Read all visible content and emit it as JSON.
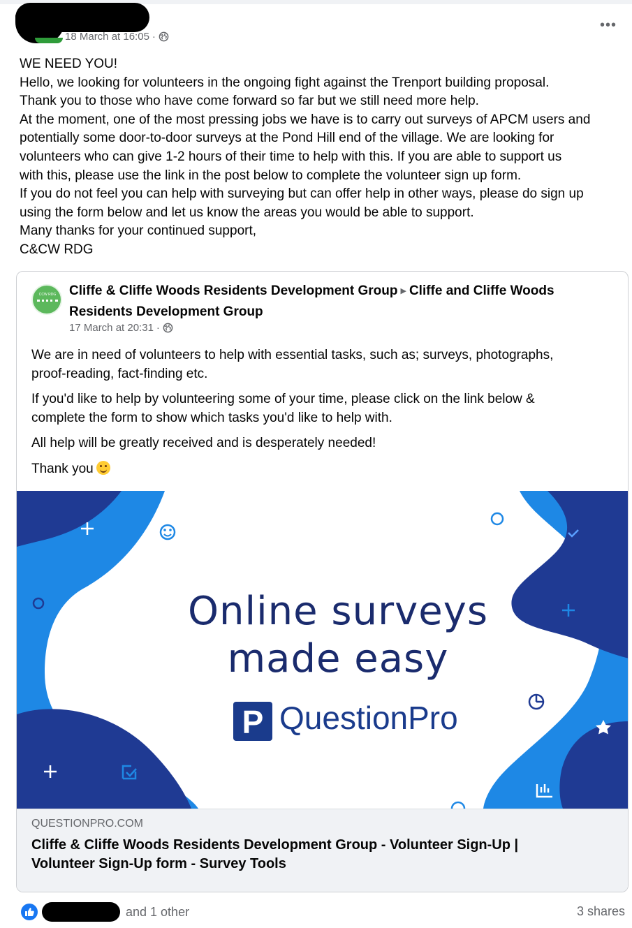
{
  "post": {
    "timestamp": "18 March at 16:05",
    "audience_icon": "globe-icon",
    "more_label": "•••",
    "body_lines": [
      "WE NEED YOU!",
      "Hello, we looking for volunteers in the ongoing fight against the Trenport building proposal.",
      "Thank you to those who have come forward so far but we still need more help.",
      "At the moment, one of the most pressing jobs we have is to carry out surveys of APCM users and",
      "potentially some door-to-door surveys at the Pond Hill end of the village. We are looking for",
      "volunteers who can give 1-2 hours of their time to help with this. If you are able to support us",
      "with this, please use the link in the post below to complete the volunteer sign up form.",
      "If you do not feel you can help with surveying but can offer help in other ways, please do sign up",
      "using the form below and let us know the areas you would be able to support.",
      "Many thanks for your continued support,",
      "C&CW RDG"
    ]
  },
  "shared_post": {
    "author": "Cliffe & Cliffe Woods Residents Development Group",
    "target_line1": "Cliffe and Cliffe Woods",
    "target_line2": "Residents Development Group",
    "timestamp": "17 March at 20:31",
    "paragraphs": [
      [
        "We are in need of volunteers to help with essential tasks, such as; surveys, photographs,",
        "proof-reading, fact-finding etc."
      ],
      [
        "If you'd like to help by volunteering some of your time, please click on the link below &",
        "complete the form to show which tasks you'd like to help with."
      ],
      [
        "All help will be greatly received and is desperately needed!"
      ]
    ],
    "thanks": "Thank you",
    "emoji": "smiling-face-icon"
  },
  "banner": {
    "line1": "Online surveys",
    "line2": "made easy",
    "brand": "QuestionPro",
    "logo_letter": "P",
    "colors": {
      "dark_blue": "#1f3a93",
      "bright_blue": "#1e88e5",
      "text": "#1a2b6d"
    }
  },
  "link": {
    "domain": "QUESTIONPRO.COM",
    "title_line1": "Cliffe & Cliffe Woods Residents Development Group - Volunteer Sign-Up |",
    "title_line2": "Volunteer Sign-Up form - Survey Tools"
  },
  "footer": {
    "reactors_suffix": "and 1 other",
    "shares": "3 shares",
    "reaction_icon": "like-icon"
  }
}
